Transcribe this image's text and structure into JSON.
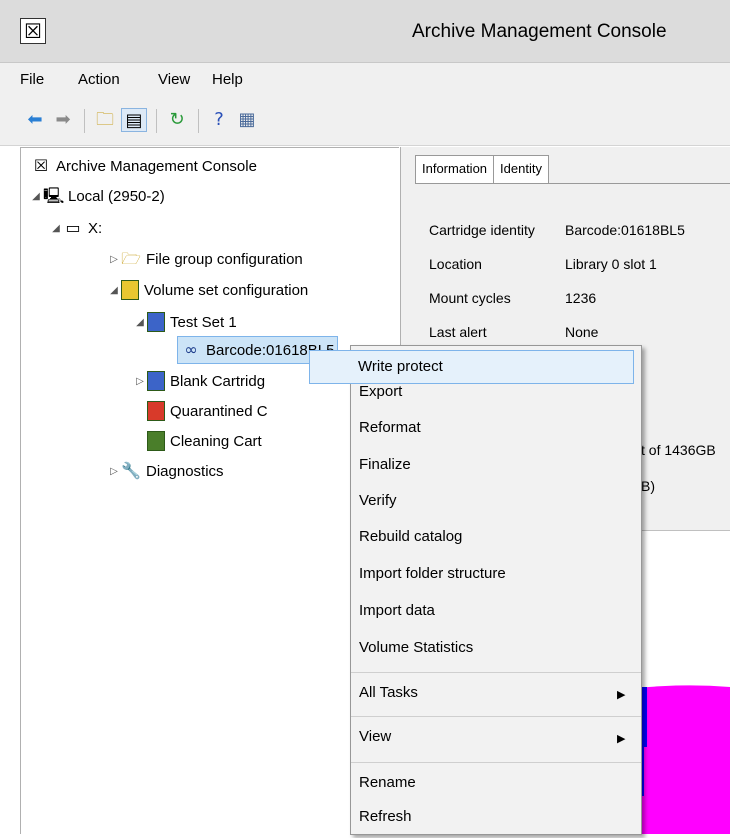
{
  "window": {
    "title": "Archive Management Console",
    "icon": "app-logo-icon"
  },
  "menu": [
    "File",
    "Action",
    "View",
    "Help"
  ],
  "toolbar": {
    "icons": [
      "back-arrow-icon",
      "forward-arrow-icon",
      "up-folder-icon",
      "show-hide-tree-icon",
      "refresh-icon",
      "help-icon",
      "action-pane-icon"
    ],
    "colors": {
      "back": "#2a7fd4",
      "forward": "#8a8a8a"
    }
  },
  "tree": {
    "root": "Archive Management Console",
    "local": "Local (2950-2)",
    "drive": "X:",
    "file_group": "File group configuration",
    "volume_set": "Volume set configuration",
    "test_set": "Test Set 1",
    "barcode": "Barcode:01618BL5",
    "blank": "Blank Cartridg",
    "quarantined": "Quarantined C",
    "cleaning": "Cleaning Cart",
    "diagnostics": "Diagnostics"
  },
  "details": {
    "tabs": [
      "Information",
      "Identity"
    ],
    "rows": [
      {
        "label": "Cartridge identity",
        "value": "Barcode:01618BL5"
      },
      {
        "label": "Location",
        "value": "Library 0 slot 1"
      },
      {
        "label": "Mount cycles",
        "value": "1236"
      },
      {
        "label": "Last alert",
        "value": "None"
      }
    ],
    "partial1": "t of 1436GB",
    "partial2": "B)"
  },
  "context_menu": {
    "items": [
      "Write protect",
      "Export",
      "Reformat",
      "Finalize",
      "Verify",
      "Rebuild catalog",
      "Import folder structure",
      "Import data",
      "Volume Statistics",
      "All Tasks",
      "View",
      "Rename",
      "Refresh"
    ],
    "highlighted": "Write protect"
  },
  "graph": {
    "colors": {
      "fill": "#ff00ff",
      "bar": "#0000ff"
    }
  }
}
